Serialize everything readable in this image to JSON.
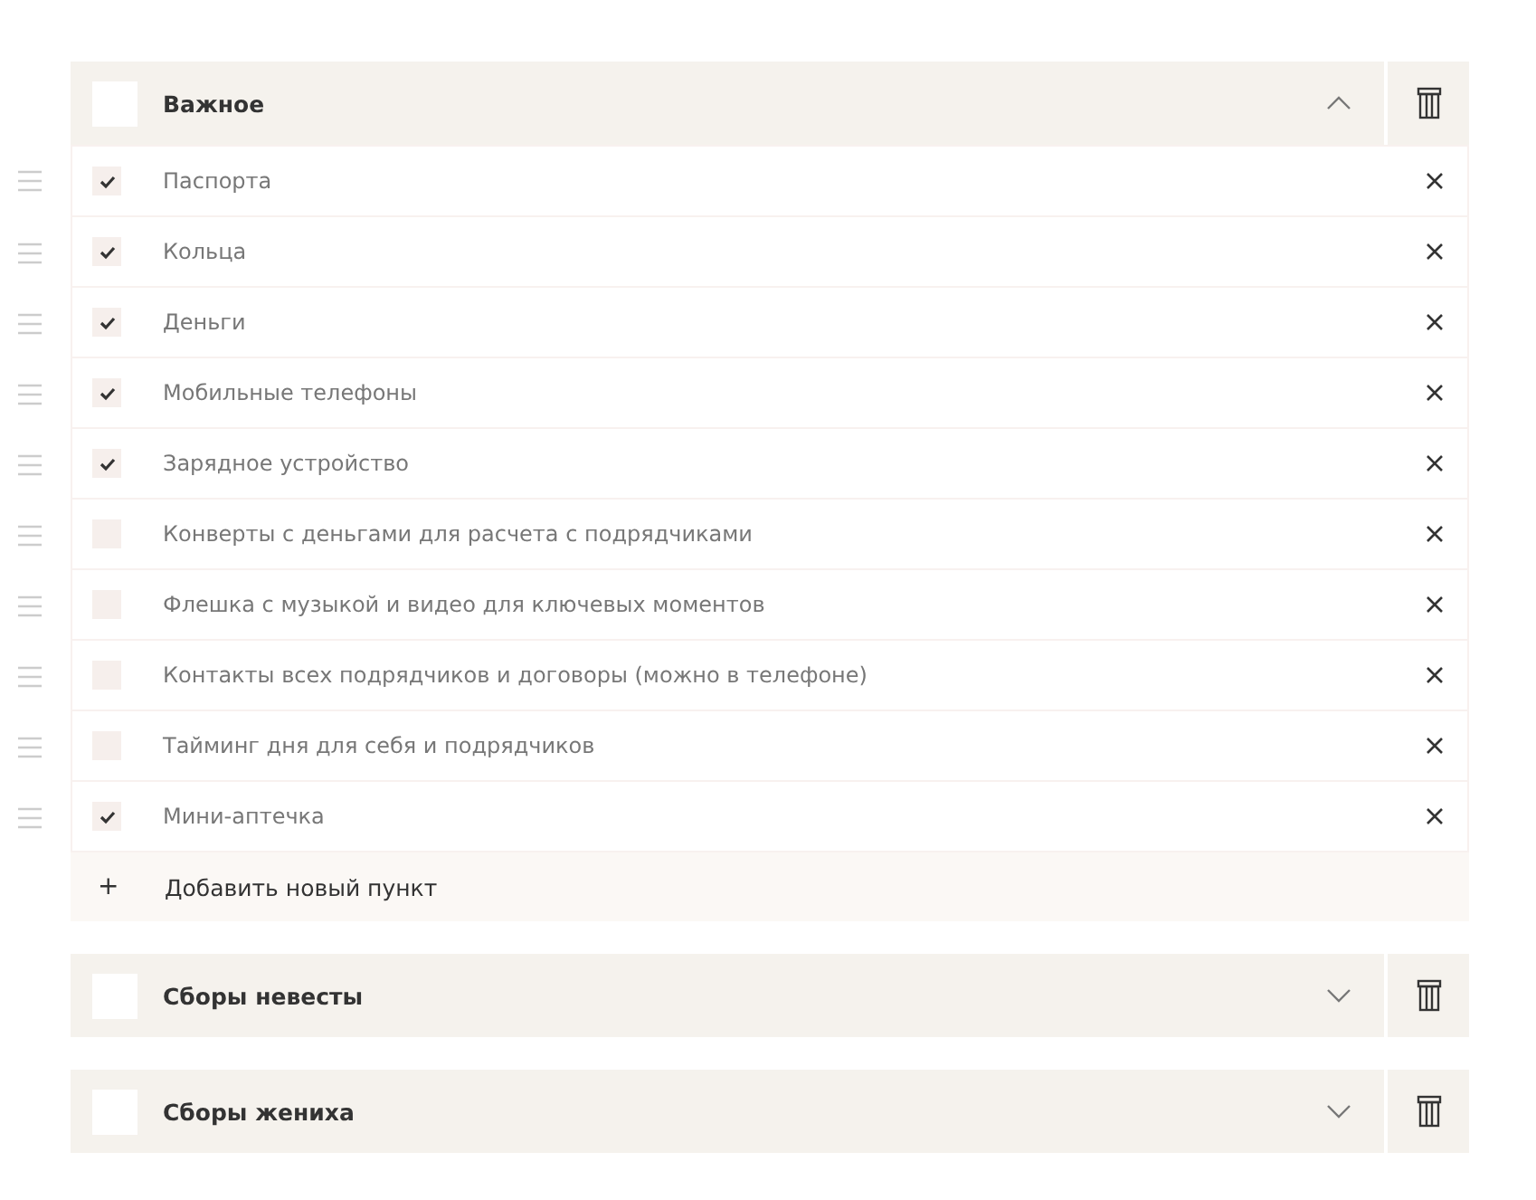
{
  "groups": [
    {
      "title": "Важное",
      "checked": false,
      "expanded": true,
      "items": [
        {
          "label": "Паспорта",
          "checked": true
        },
        {
          "label": "Кольца",
          "checked": true
        },
        {
          "label": "Деньги",
          "checked": true
        },
        {
          "label": "Мобильные телефоны",
          "checked": true
        },
        {
          "label": "Зарядное устройство",
          "checked": true
        },
        {
          "label": "Конверты с деньгами для расчета с подрядчиками",
          "checked": false
        },
        {
          "label": "Флешка с музыкой и видео для ключевых моментов",
          "checked": false
        },
        {
          "label": "Контакты всех подрядчиков и договоры (можно в телефоне)",
          "checked": false
        },
        {
          "label": "Тайминг дня для себя и подрядчиков",
          "checked": false
        },
        {
          "label": "Мини-аптечка",
          "checked": true
        }
      ],
      "add_icon": "+",
      "add_label": "Добавить новый пункт"
    },
    {
      "title": "Сборы невесты",
      "checked": false,
      "expanded": false
    },
    {
      "title": "Сборы жениха",
      "checked": false,
      "expanded": false
    }
  ]
}
